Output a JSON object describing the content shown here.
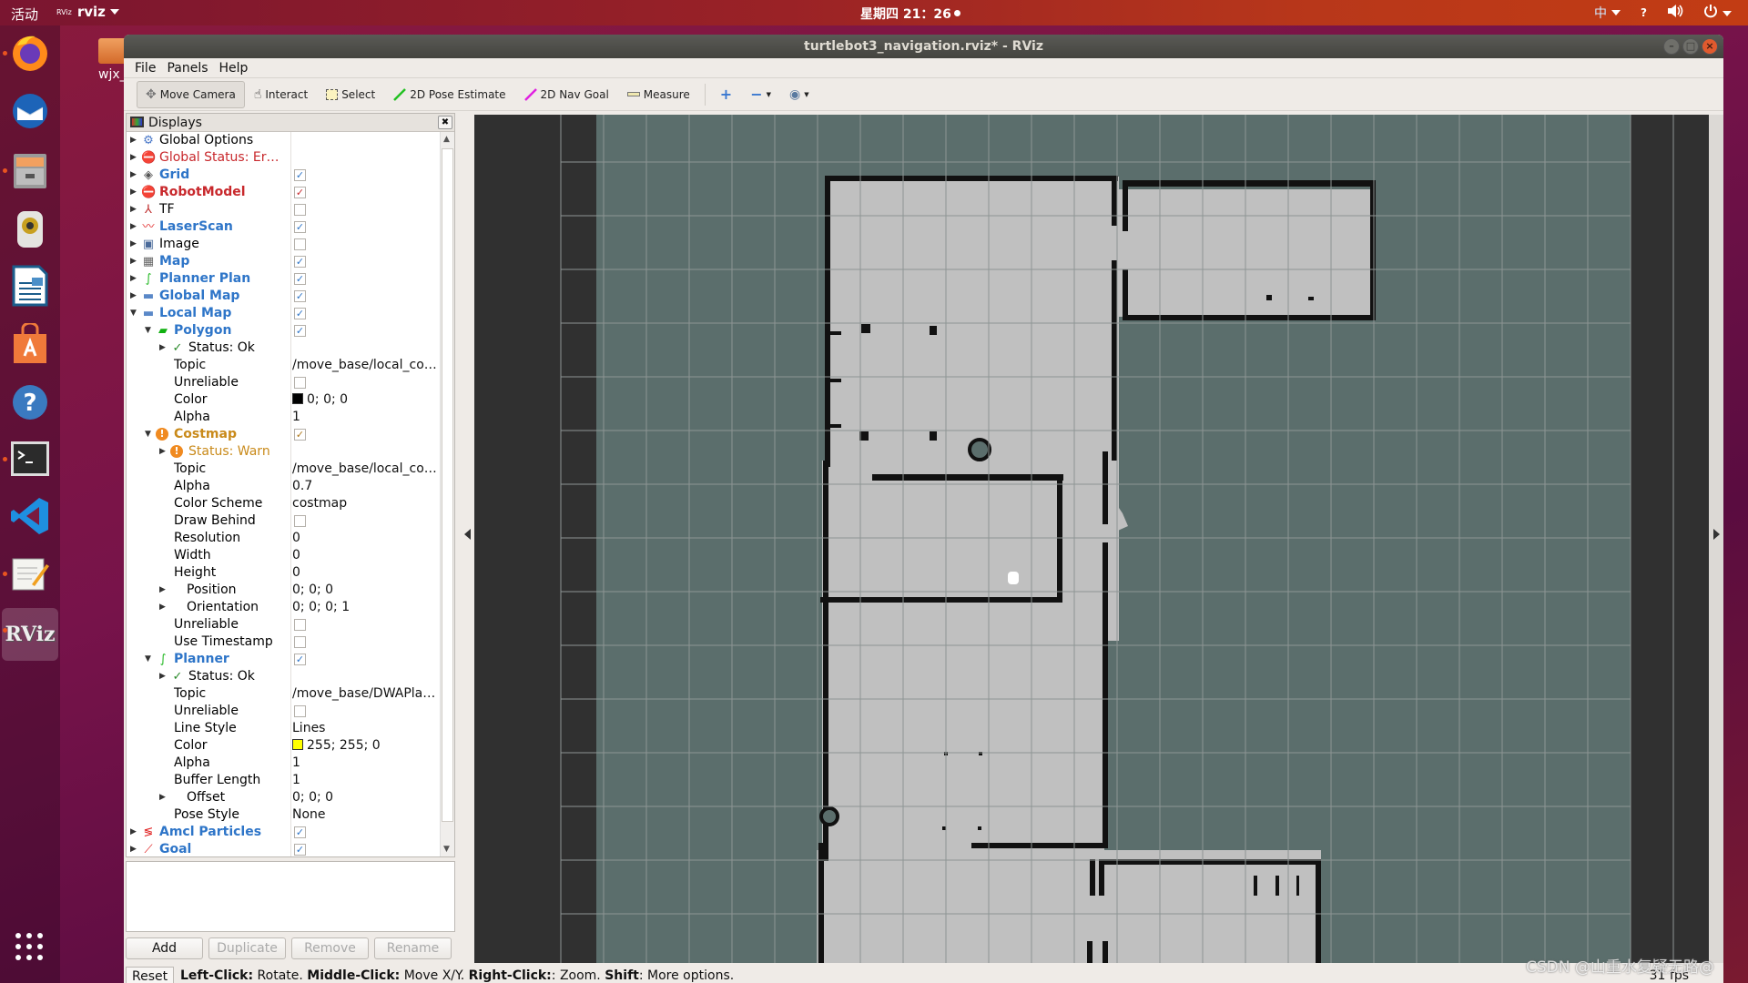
{
  "topbar": {
    "activities": "活动",
    "app_icon_text": "RViz",
    "app_name": "rviz",
    "clock": "星期四 21：26",
    "input_method": "中",
    "help": "?",
    "volume_icon": "volume-icon",
    "power_icon": "power-icon"
  },
  "dock": {
    "items": [
      {
        "name": "Firefox",
        "icon": "firefox-icon",
        "running": true
      },
      {
        "name": "Thunderbird",
        "icon": "mail-icon",
        "running": false
      },
      {
        "name": "Files",
        "icon": "file-cabinet-icon",
        "running": true
      },
      {
        "name": "Rhythmbox",
        "icon": "speaker-icon",
        "running": false
      },
      {
        "name": "LibreOffice Writer",
        "icon": "document-icon",
        "running": false
      },
      {
        "name": "Ubuntu Software",
        "icon": "shopping-bag-icon",
        "running": false
      },
      {
        "name": "Help",
        "icon": "help-icon",
        "running": false
      },
      {
        "name": "Terminal",
        "icon": "terminal-icon",
        "running": true
      },
      {
        "name": "VS Code",
        "icon": "vscode-icon",
        "running": false
      },
      {
        "name": "Text Editor",
        "icon": "notepad-icon",
        "running": true
      },
      {
        "name": "RViz",
        "icon": "rviz-icon",
        "running": true,
        "active": true
      }
    ],
    "apps_grid_icon": "apps-grid-icon"
  },
  "desktop": {
    "folder_label": "wjx_"
  },
  "window": {
    "title": "turtlebot3_navigation.rviz* - RViz",
    "menu": [
      "File",
      "Panels",
      "Help"
    ],
    "toolbar": [
      {
        "label": "Move Camera",
        "icon": "move-camera-icon",
        "active": true
      },
      {
        "label": "Interact",
        "icon": "hand-icon"
      },
      {
        "label": "Select",
        "icon": "select-box-icon"
      },
      {
        "label": "2D Pose Estimate",
        "icon": "green-arrow-icon"
      },
      {
        "label": "2D Nav Goal",
        "icon": "magenta-arrow-icon"
      },
      {
        "label": "Measure",
        "icon": "ruler-icon"
      }
    ],
    "toolbar_extra": [
      "plus-icon",
      "minus-icon",
      "eye-icon"
    ]
  },
  "displays": {
    "title": "Displays",
    "rows": [
      {
        "depth": 0,
        "arrow": "right",
        "icon": "gear-icon",
        "label": "Global Options",
        "style": ""
      },
      {
        "depth": 0,
        "arrow": "right",
        "icon": "error-icon",
        "label": "Global Status: Er…",
        "style": "err"
      },
      {
        "depth": 0,
        "arrow": "right",
        "icon": "grid-icon",
        "label": "Grid",
        "style": "b",
        "check": "blue"
      },
      {
        "depth": 0,
        "arrow": "right",
        "icon": "error-icon",
        "label": "RobotModel",
        "style": "errb",
        "check": "red"
      },
      {
        "depth": 0,
        "arrow": "right",
        "icon": "tf-axes-icon",
        "label": "TF",
        "style": "",
        "check": "empty"
      },
      {
        "depth": 0,
        "arrow": "right",
        "icon": "laserscan-icon",
        "label": "LaserScan",
        "style": "b",
        "check": "blue"
      },
      {
        "depth": 0,
        "arrow": "right",
        "icon": "image-icon",
        "label": "Image",
        "style": "",
        "check": "empty"
      },
      {
        "depth": 0,
        "arrow": "right",
        "icon": "map-icon",
        "label": "Map",
        "style": "b",
        "check": "blue"
      },
      {
        "depth": 0,
        "arrow": "right",
        "icon": "path-icon",
        "label": "Planner Plan",
        "style": "b",
        "check": "blue"
      },
      {
        "depth": 0,
        "arrow": "right",
        "icon": "folder-icon",
        "label": "Global Map",
        "style": "b",
        "check": "blue"
      },
      {
        "depth": 0,
        "arrow": "down",
        "icon": "folder-icon",
        "label": "Local Map",
        "style": "b",
        "check": "blue"
      },
      {
        "depth": 1,
        "arrow": "down",
        "icon": "polygon-icon",
        "label": "Polygon",
        "style": "b",
        "check": "blue"
      },
      {
        "depth": 2,
        "arrow": "right",
        "icon": "check-icon",
        "label": "Status: Ok",
        "style": ""
      },
      {
        "depth": 3,
        "label": "Topic",
        "value": "/move_base/local_co…"
      },
      {
        "depth": 3,
        "label": "Unreliable",
        "check": "empty"
      },
      {
        "depth": 3,
        "label": "Color",
        "value": "0; 0; 0",
        "swatch": "#000000"
      },
      {
        "depth": 3,
        "label": "Alpha",
        "value": "1"
      },
      {
        "depth": 1,
        "arrow": "down",
        "icon": "warning-icon",
        "label": "Costmap",
        "style": "warnb",
        "check": "orange"
      },
      {
        "depth": 2,
        "arrow": "right",
        "icon": "warning-icon",
        "label": "Status: Warn",
        "style": "warn"
      },
      {
        "depth": 3,
        "label": "Topic",
        "value": "/move_base/local_co…"
      },
      {
        "depth": 3,
        "label": "Alpha",
        "value": "0.7"
      },
      {
        "depth": 3,
        "label": "Color Scheme",
        "value": "costmap"
      },
      {
        "depth": 3,
        "label": "Draw Behind",
        "check": "empty"
      },
      {
        "depth": 3,
        "label": "Resolution",
        "value": "0"
      },
      {
        "depth": 3,
        "label": "Width",
        "value": "0"
      },
      {
        "depth": 3,
        "label": "Height",
        "value": "0"
      },
      {
        "depth": 2,
        "arrow": "right",
        "label": "Position",
        "value": "0; 0; 0",
        "noicon": true
      },
      {
        "depth": 2,
        "arrow": "right",
        "label": "Orientation",
        "value": "0; 0; 0; 1",
        "noicon": true
      },
      {
        "depth": 3,
        "label": "Unreliable",
        "check": "empty"
      },
      {
        "depth": 3,
        "label": "Use Timestamp",
        "check": "empty"
      },
      {
        "depth": 1,
        "arrow": "down",
        "icon": "path-icon",
        "label": "Planner",
        "style": "b",
        "check": "blue"
      },
      {
        "depth": 2,
        "arrow": "right",
        "icon": "check-icon",
        "label": "Status: Ok",
        "style": ""
      },
      {
        "depth": 3,
        "label": "Topic",
        "value": "/move_base/DWAPla…"
      },
      {
        "depth": 3,
        "label": "Unreliable",
        "check": "empty"
      },
      {
        "depth": 3,
        "label": "Line Style",
        "value": "Lines"
      },
      {
        "depth": 3,
        "label": "Color",
        "value": "255; 255; 0",
        "swatch": "#ffff00"
      },
      {
        "depth": 3,
        "label": "Alpha",
        "value": "1"
      },
      {
        "depth": 3,
        "label": "Buffer Length",
        "value": "1"
      },
      {
        "depth": 2,
        "arrow": "right",
        "label": "Offset",
        "value": "0; 0; 0",
        "noicon": true
      },
      {
        "depth": 3,
        "label": "Pose Style",
        "value": "None"
      },
      {
        "depth": 0,
        "arrow": "right",
        "icon": "particles-icon",
        "label": "Amcl Particles",
        "style": "b",
        "check": "blue"
      },
      {
        "depth": 0,
        "arrow": "right",
        "icon": "goal-arrow-icon",
        "label": "Goal",
        "style": "b",
        "check": "blue"
      }
    ],
    "buttons": [
      {
        "label": "Add",
        "enabled": true
      },
      {
        "label": "Duplicate",
        "enabled": false
      },
      {
        "label": "Remove",
        "enabled": false
      },
      {
        "label": "Rename",
        "enabled": false
      }
    ]
  },
  "statusbar": {
    "reset": "Reset",
    "hint_parts": [
      {
        "b": "Left-Click:",
        "t": " Rotate. "
      },
      {
        "b": "Middle-Click:",
        "t": " Move X/Y. "
      },
      {
        "b": "Right-Click:",
        "t": ": Zoom. "
      },
      {
        "b": "Shift",
        "t": ": More options."
      }
    ],
    "fps": "31 fps"
  },
  "watermark": "CSDN @山重水复疑无路@",
  "colors": {
    "viewport_bg": "#303030",
    "map_unknown": "#5b6e6c",
    "map_free": "#c0c0c0",
    "map_wall": "#111111",
    "accent_blue": "#2e75c8",
    "error_red": "#c8282c",
    "warn_orange": "#c98a1a"
  }
}
